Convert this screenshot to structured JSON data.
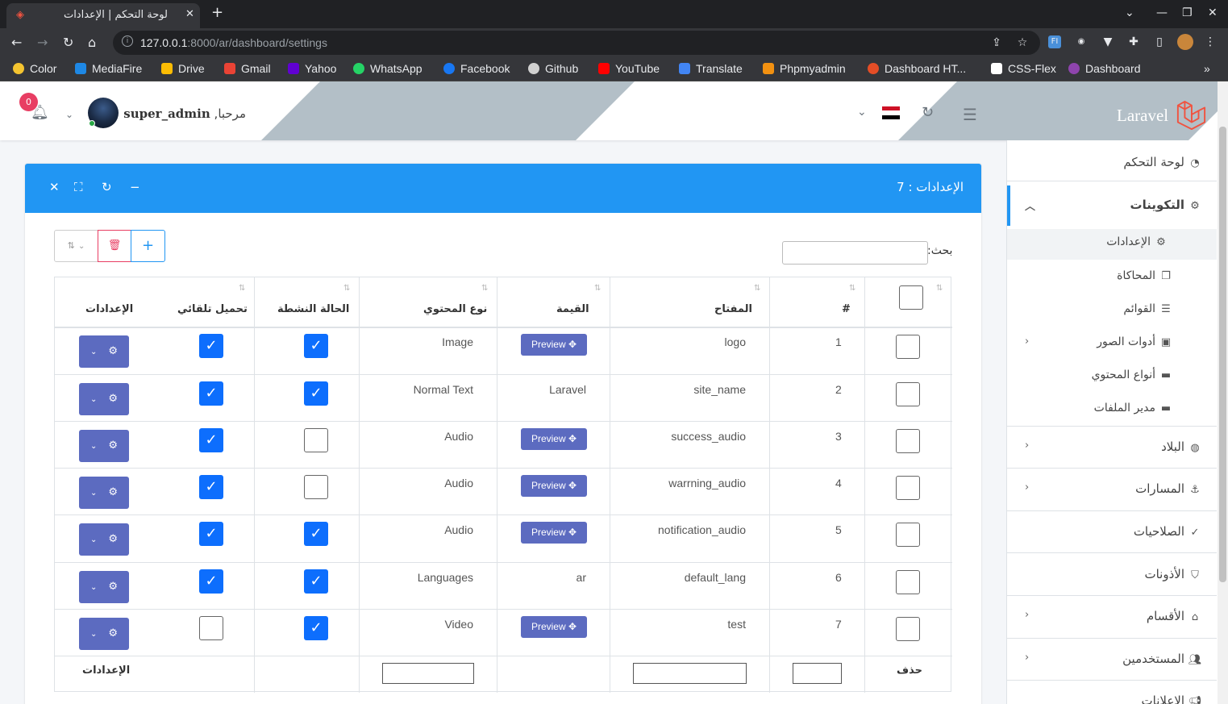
{
  "browser": {
    "tab_title": "لوحة التحكم | الإعدادات",
    "url_host": "127.0.0.1",
    "url_path": ":8000/ar/dashboard/settings"
  },
  "bookmarks": [
    {
      "label": "Color",
      "color": "#f4c430"
    },
    {
      "label": "MediaFire",
      "color": "#1e88e5"
    },
    {
      "label": "Drive",
      "color": "#fbbc04"
    },
    {
      "label": "Gmail",
      "color": "#ea4335"
    },
    {
      "label": "Yahoo",
      "color": "#6001d2"
    },
    {
      "label": "WhatsApp",
      "color": "#25d366"
    },
    {
      "label": "Facebook",
      "color": "#1877f2"
    },
    {
      "label": "Github",
      "color": "#24292e"
    },
    {
      "label": "YouTube",
      "color": "#ff0000"
    },
    {
      "label": "Translate",
      "color": "#4285f4"
    },
    {
      "label": "Phpmyadmin",
      "color": "#f29111"
    },
    {
      "label": "Dashboard HT...",
      "color": "#e44d26"
    },
    {
      "label": "CSS-Flex",
      "color": "#111111"
    },
    {
      "label": "Dashboard",
      "color": "#8e44ad"
    }
  ],
  "navbar": {
    "brand": "Laravel",
    "greeting_prefix": "مرحبا,",
    "username": "super_admin",
    "notification_count": "0"
  },
  "sidebar": {
    "dashboard": "لوحة التحكم",
    "configs": "التكوينات",
    "settings": "الإعدادات",
    "simulation": "المحاكاة",
    "menus": "القوائم",
    "image_tools": "أدوات الصور",
    "content_types": "أنواع المحتوي",
    "file_manager": "مدير الملفات",
    "countries": "البلاد",
    "routes": "المسارات",
    "roles": "الصلاحيات",
    "permissions": "الأذونات",
    "sections": "الأقسام",
    "users": "المستخدمين",
    "ads": "الإعلانات"
  },
  "card": {
    "title": "الإعدادات : 7",
    "search_label": "بحث:"
  },
  "table": {
    "headers": {
      "num": "#",
      "key": "المفتاح",
      "value": "القيمة",
      "content_type": "نوع المحتوي",
      "active": "الحالة النشطة",
      "autoload": "تحميل تلقائي",
      "actions": "الإعدادات"
    },
    "rows": [
      {
        "num": "1",
        "key": "logo",
        "value": "",
        "preview": "Preview",
        "type": "Image",
        "active": true,
        "autoload": true
      },
      {
        "num": "2",
        "key": "site_name",
        "value": "Laravel",
        "preview": "",
        "type": "Normal Text",
        "active": true,
        "autoload": true
      },
      {
        "num": "3",
        "key": "success_audio",
        "value": "",
        "preview": "Preview",
        "type": "Audio",
        "active": false,
        "autoload": true
      },
      {
        "num": "4",
        "key": "warrning_audio",
        "value": "",
        "preview": "Preview",
        "type": "Audio",
        "active": false,
        "autoload": true
      },
      {
        "num": "5",
        "key": "notification_audio",
        "value": "",
        "preview": "Preview",
        "type": "Audio",
        "active": true,
        "autoload": true
      },
      {
        "num": "6",
        "key": "default_lang",
        "value": "ar",
        "preview": "",
        "type": "Languages",
        "active": true,
        "autoload": true
      },
      {
        "num": "7",
        "key": "test",
        "value": "",
        "preview": "Preview",
        "type": "Video",
        "active": true,
        "autoload": false
      }
    ],
    "footer": {
      "delete": "حذف",
      "actions": "الإعدادات"
    }
  },
  "colors": {
    "card_header": "#2196f3",
    "action_button": "#5c6bc0",
    "checkbox_checked": "#0d6efd",
    "delete_red": "#e83e63"
  }
}
